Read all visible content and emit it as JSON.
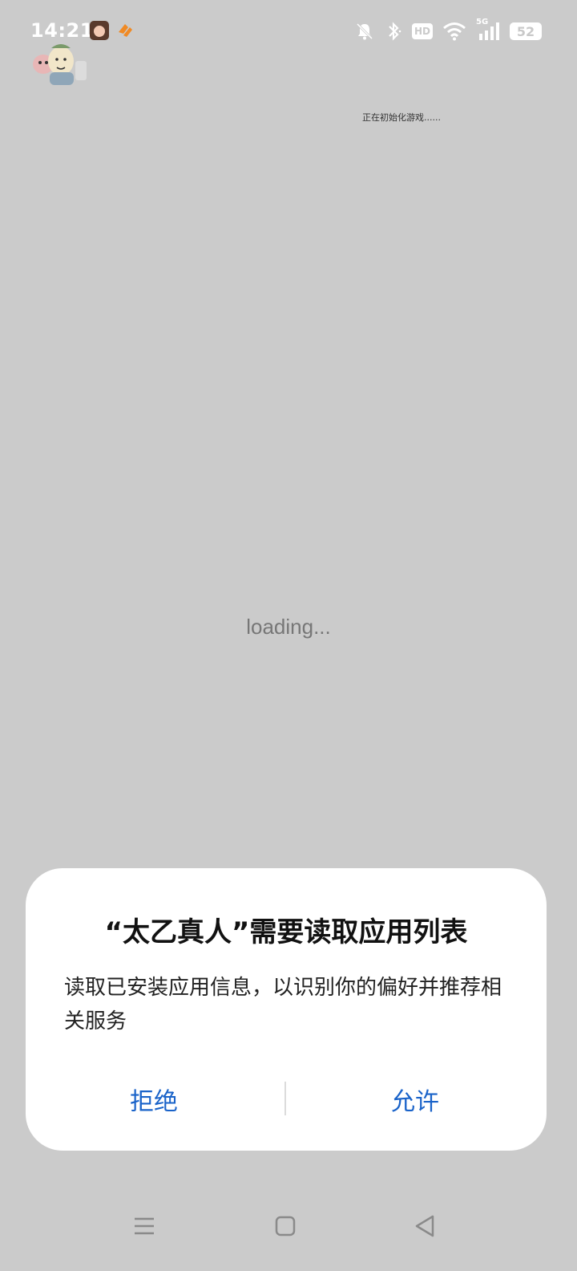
{
  "status_bar": {
    "time": "14:21",
    "hd_label": "HD",
    "network_label": "5G",
    "battery_level": "52"
  },
  "page": {
    "hint_text": "正在初始化游戏......",
    "loading_text": "loading..."
  },
  "dialog": {
    "title": "“太乙真人”需要读取应用列表",
    "message": "读取已安装应用信息，以识别你的偏好并推荐相关服务",
    "deny_label": "拒绝",
    "allow_label": "允许"
  },
  "colors": {
    "background": "#cbcbcb",
    "accent": "#1a63c9",
    "dialog_bg": "#ffffff"
  },
  "icons": {
    "status": [
      "mute-bell-icon",
      "bluetooth-icon",
      "hd-icon",
      "wifi-icon",
      "signal-5g-icon",
      "battery-icon"
    ],
    "nav": [
      "menu-icon",
      "home-icon",
      "back-icon"
    ]
  }
}
